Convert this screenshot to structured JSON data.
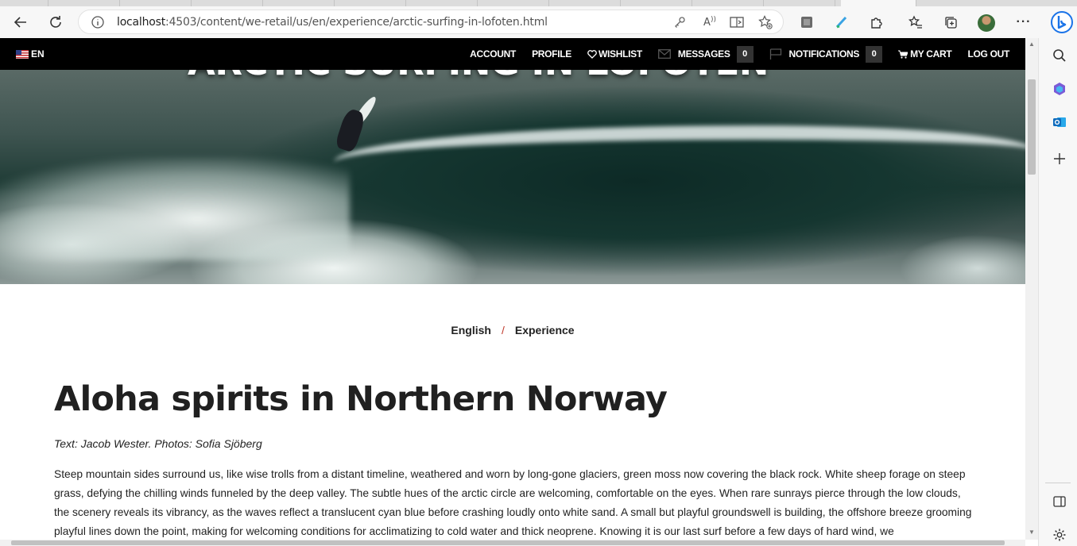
{
  "browser": {
    "url_host": "localhost",
    "url_rest": ":4503/content/we-retail/us/en/experience/arctic-surfing-in-lofoten.html"
  },
  "site_nav": {
    "language": "EN",
    "account": "ACCOUNT",
    "profile": "PROFILE",
    "wishlist": "WISHLIST",
    "messages": "MESSAGES",
    "messages_count": "0",
    "notifications": "NOTIFICATIONS",
    "notifications_count": "0",
    "cart": "MY CART",
    "logout": "LOG OUT"
  },
  "hero": {
    "title": "ARCTIC SURFING IN LOFOTEN"
  },
  "breadcrumb": {
    "items": [
      "English",
      "Experience"
    ],
    "separator": "/"
  },
  "article": {
    "title": "Aloha spirits in Northern Norway",
    "byline": "Text: Jacob Wester. Photos: Sofia Sjöberg",
    "body": "Steep mountain sides surround us, like wise trolls from a distant timeline, weathered and worn by long-gone glaciers, green moss now covering the black rock. White sheep forage on steep grass, defying the chilling winds funneled by the deep valley. The subtle hues of the arctic circle are welcoming, comfortable on the eyes. When rare sunrays pierce through the low clouds, the scenery reveals its vibrancy, as the waves reflect a translucent cyan blue before crashing loudly onto white sand. A small but playful groundswell is building, the offshore breeze grooming playful lines down the point, making for welcoming conditions for acclimatizing to cold water and thick neoprene. Knowing it is our last surf before a few days of hard wind, we"
  },
  "colors": {
    "nav_background": "#000000",
    "accent_separator": "#c0392b",
    "edge_accent": "#1a73e8"
  }
}
